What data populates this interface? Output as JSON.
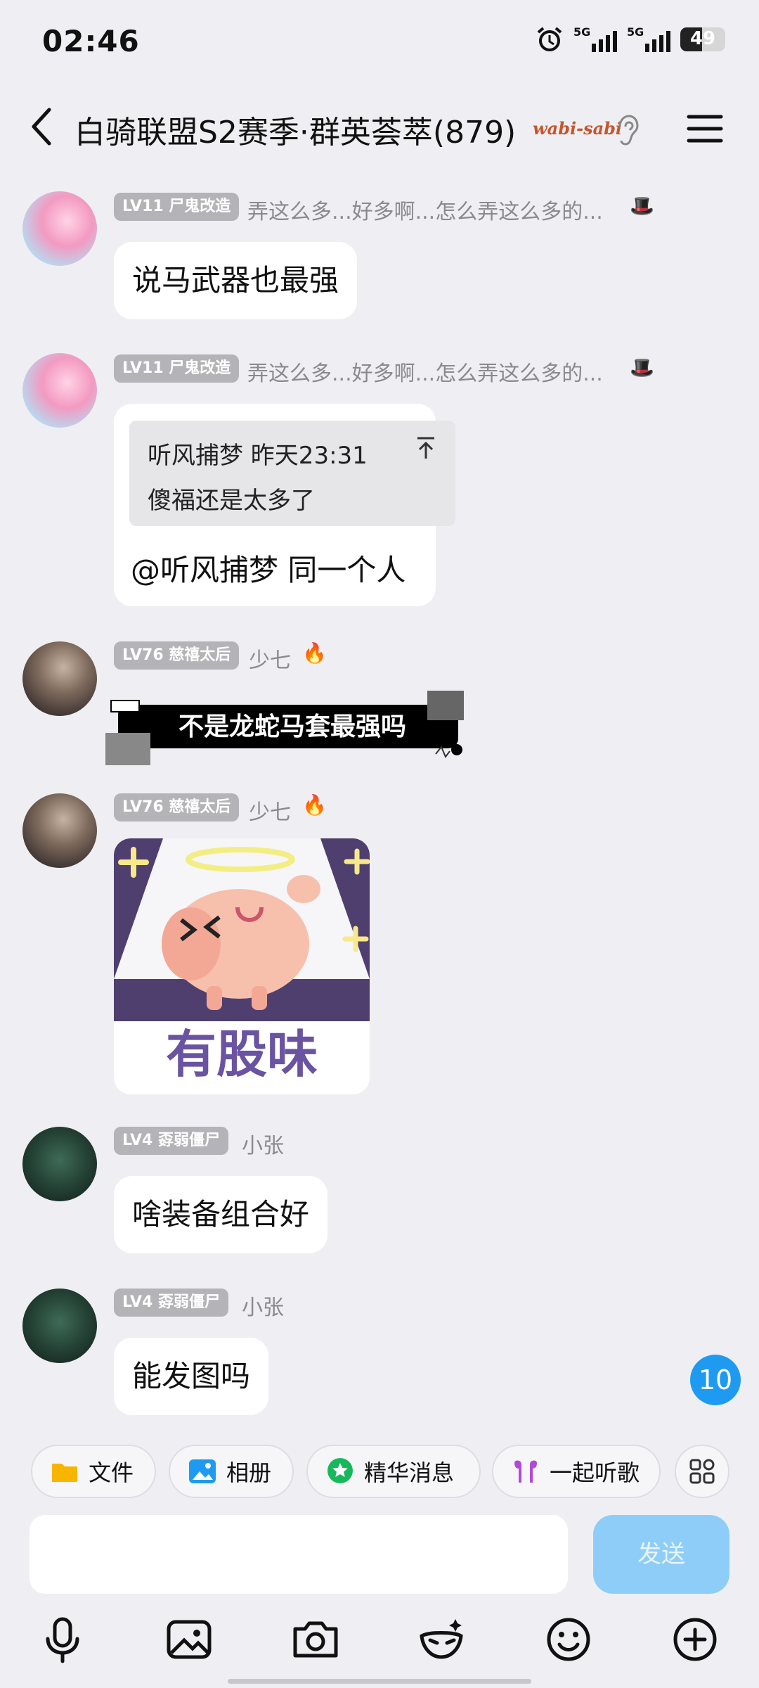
{
  "status": {
    "time": "02:46",
    "net1": "5G",
    "net2": "5G",
    "battery": "49"
  },
  "header": {
    "title": "白骑联盟S2赛季·群英荟萃(879)",
    "logo_text": "wabi-sabi"
  },
  "messages": [
    {
      "level": "LV11 尸鬼改造",
      "nick": "弄这么多...好多啊...怎么弄这么多的...",
      "text": "说马武器也最强"
    },
    {
      "level": "LV11 尸鬼改造",
      "nick": "弄这么多...好多啊...怎么弄这么多的...",
      "quote_head": "听风捕梦 昨天23:31",
      "quote_text": "傻福还是太多了",
      "text": "@听风捕梦 同一个人"
    },
    {
      "level": "LV76 慈禧太后",
      "nick": "少七",
      "sticker_text": "不是龙蛇马套最强吗"
    },
    {
      "level": "LV76 慈禧太后",
      "nick": "少七",
      "sticker_text": "有股味"
    },
    {
      "level": "LV4 孬弱僵尸",
      "nick": "小张",
      "text": "啥装备组合好"
    },
    {
      "level": "LV4 孬弱僵尸",
      "nick": "小张",
      "text": "能发图吗"
    }
  ],
  "unread_count": "10",
  "shortcuts": [
    "文件",
    "相册",
    "精华消息",
    "一起听歌"
  ],
  "input": {
    "placeholder": "",
    "send_label": "发送"
  },
  "colors": {
    "accent": "#1e9bf0",
    "send_disabled": "#8ecdf7",
    "background": "#efeff3"
  }
}
